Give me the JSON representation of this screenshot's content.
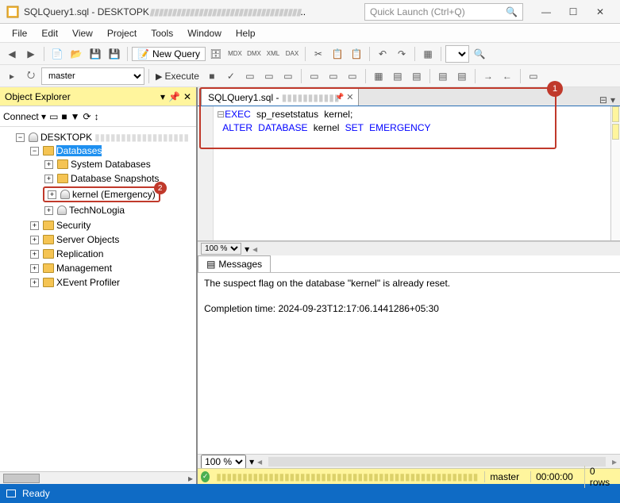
{
  "title": {
    "filename": "SQLQuery1.sql",
    "host_prefix": "DESKTOPK"
  },
  "quick_launch_placeholder": "Quick Launch (Ctrl+Q)",
  "menu": [
    "File",
    "Edit",
    "View",
    "Project",
    "Tools",
    "Window",
    "Help"
  ],
  "toolbar1": {
    "new_query": "New Query",
    "db_combo": "master",
    "execute": "Execute"
  },
  "object_explorer": {
    "title": "Object Explorer",
    "connect_label": "Connect",
    "server_prefix": "DESKTOPK",
    "tree": {
      "databases": "Databases",
      "sysdb": "System Databases",
      "snapshots": "Database Snapshots",
      "kernel": "kernel (Emergency)",
      "techno": "TechNoLogia",
      "security": "Security",
      "server_objects": "Server Objects",
      "replication": "Replication",
      "management": "Management",
      "xevent": "XEvent Profiler"
    }
  },
  "editor": {
    "tab_name": "SQLQuery1.sql - ",
    "code_line1_kw1": "EXEC",
    "code_line1_proc": "sp_resetstatus",
    "code_line1_arg": "kernel;",
    "code_line2_kw1": "ALTER",
    "code_line2_kw2": "DATABASE",
    "code_line2_arg": "kernel",
    "code_line2_kw3": "SET",
    "code_line2_kw4": "EMERGENCY",
    "zoom": "100 %"
  },
  "messages": {
    "tab": "Messages",
    "line1": "The suspect flag on the database \"kernel\" is already reset.",
    "line2": "Completion time: 2024-09-23T12:17:06.1441286+05:30"
  },
  "statusbar": {
    "db": "master",
    "time": "00:00:00",
    "rows": "0 rows"
  },
  "app_status": "Ready",
  "annotations": {
    "one": "1",
    "two": "2"
  }
}
